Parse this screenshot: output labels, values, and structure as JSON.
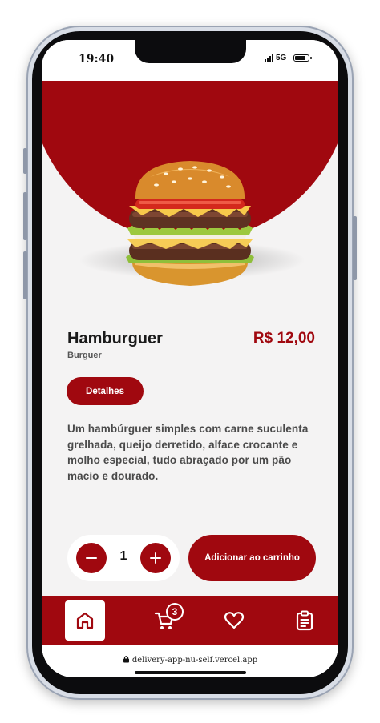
{
  "status": {
    "time": "19:40",
    "network": "5G",
    "battery_level": 0.85
  },
  "product": {
    "name": "Hamburguer",
    "category": "Burguer",
    "price": "R$ 12,00",
    "details_label": "Detalhes",
    "description": "Um hambúrguer simples com carne suculenta grelhada, queijo derretido, alface crocante e molho especial, tudo abraçado por um pão macio e dourado."
  },
  "cart": {
    "quantity": "1",
    "add_label": "Adicionar ao carrinho"
  },
  "nav": {
    "items": [
      {
        "icon": "home-icon",
        "active": true
      },
      {
        "icon": "cart-icon",
        "badge": "3"
      },
      {
        "icon": "heart-icon"
      },
      {
        "icon": "clipboard-icon"
      }
    ]
  },
  "browser": {
    "url": "delivery-app-nu-self.vercel.app"
  },
  "colors": {
    "accent": "#a0080f",
    "background": "#f4f3f3"
  }
}
